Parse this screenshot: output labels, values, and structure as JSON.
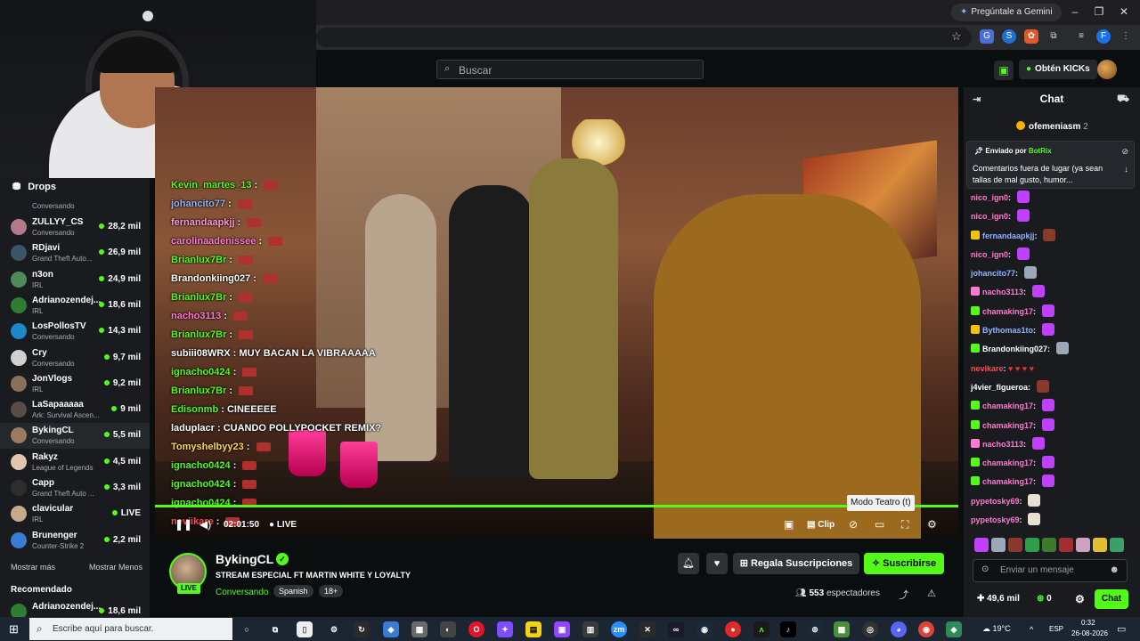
{
  "browser": {
    "gemini_label": "Pregúntale a Gemini"
  },
  "header": {
    "search_placeholder": "Buscar",
    "kicks_label": "Obtén KICKs"
  },
  "sidebar": {
    "drops_label": "Drops",
    "top_partial": {
      "category": "Conversando"
    },
    "following": [
      {
        "name": "ZULLYY_CS",
        "category": "Conversando",
        "viewers": "28,2 mil",
        "color": "#b37a8c"
      },
      {
        "name": "RDjavi",
        "category": "Grand Theft Auto...",
        "viewers": "26,9 mil",
        "color": "#3b5566"
      },
      {
        "name": "n3on",
        "category": "IRL",
        "viewers": "24,9 mil",
        "color": "#4f8a5a"
      },
      {
        "name": "Adrianozendej...",
        "category": "IRL",
        "viewers": "18,6 mil",
        "color": "#2e7d32"
      },
      {
        "name": "LosPollosTV",
        "category": "Conversando",
        "viewers": "14,3 mil",
        "color": "#1b88c9"
      },
      {
        "name": "Cry",
        "category": "Conversando",
        "viewers": "9,7 mil",
        "color": "#d0d0d0"
      },
      {
        "name": "JonVlogs",
        "category": "IRL",
        "viewers": "9,2 mil",
        "color": "#8a6f5a"
      },
      {
        "name": "LaSapaaaaa",
        "category": "Ark: Survival Ascen...",
        "viewers": "9 mil",
        "color": "#5a4b45"
      },
      {
        "name": "BykingCL",
        "category": "Conversando",
        "viewers": "5,5 mil",
        "color": "#9a7a60"
      },
      {
        "name": "Rakyz",
        "category": "League of Legends",
        "viewers": "4,5 mil",
        "color": "#e0c6b0"
      },
      {
        "name": "Capp",
        "category": "Grand Theft Auto ...",
        "viewers": "3,3 mil",
        "color": "#2d2d2d"
      },
      {
        "name": "clavicular",
        "category": "IRL",
        "viewers": "LIVE",
        "color": "#c9a88e"
      },
      {
        "name": "Brunenger",
        "category": "Counter-Strike 2",
        "viewers": "2,2 mil",
        "color": "#3a7bd5"
      }
    ],
    "show_more": "Mostrar más",
    "show_less": "Mostrar Menos",
    "recommended_title": "Recomendado",
    "recommended": [
      {
        "name": "Adrianozendej...",
        "viewers": "18,6 mil",
        "color": "#2e7d32"
      }
    ]
  },
  "video": {
    "overlay_chat": [
      {
        "user": "Kevin_martes_13",
        "color": "#53fc18",
        "text": ""
      },
      {
        "user": "johancito77",
        "color": "#8fb3ff",
        "text": ""
      },
      {
        "user": "fernandaapkjj",
        "color": "#ff9ad5",
        "text": ""
      },
      {
        "user": "carolinaadenissee",
        "color": "#ff7ad0",
        "text": ""
      },
      {
        "user": "Brianlux7Br",
        "color": "#53fc18",
        "text": ""
      },
      {
        "user": "Brandonkiing027",
        "color": "#ffffff",
        "text": ""
      },
      {
        "user": "Brianlux7Br",
        "color": "#53fc18",
        "text": ""
      },
      {
        "user": "nacho3113",
        "color": "#ff7ad0",
        "text": ""
      },
      {
        "user": "Brianlux7Br",
        "color": "#53fc18",
        "text": ""
      },
      {
        "user": "subiii08WRX",
        "color": "#ffffff",
        "text": "MUY BACAN LA VIBRAAAAA"
      },
      {
        "user": "ignacho0424",
        "color": "#53fc18",
        "text": ""
      },
      {
        "user": "Brianlux7Br",
        "color": "#53fc18",
        "text": ""
      },
      {
        "user": "Edisonmb",
        "color": "#53fc18",
        "text": "CINEEEEE"
      },
      {
        "user": "laduplacr",
        "color": "#ffffff",
        "text": "CUANDO POLLYPOCKET REMIX?"
      },
      {
        "user": "Tomyshelbyy23",
        "color": "#ffd84a",
        "text": ""
      },
      {
        "user": "ignacho0424",
        "color": "#53fc18",
        "text": ""
      },
      {
        "user": "ignacho0424",
        "color": "#53fc18",
        "text": ""
      },
      {
        "user": "ignacho0424",
        "color": "#53fc18",
        "text": ""
      },
      {
        "user": "neviikare",
        "color": "#ff4d4d",
        "text": ""
      }
    ],
    "time": "02:01:50",
    "live_label": "LIVE",
    "clip_label": "Clip",
    "tooltip": "Modo Teatro (t)"
  },
  "stream": {
    "channel": "BykingCL",
    "live_badge": "LIVE",
    "title": "STREAM ESPECIAL FT MARTIN WHITE Y LOYALTY",
    "category": "Conversando",
    "tags": [
      "Spanish",
      "18+"
    ],
    "gift_label": "Regala Suscripciones",
    "subscribe_label": "Suscribirse",
    "viewers_count": "553",
    "viewers_label": "espectadores"
  },
  "chat": {
    "title": "Chat",
    "top_gifter": "ofemeniasm",
    "top_gifter_count": "2",
    "pinned_by_label": "Enviado por",
    "pinned_by_user": "BotRix",
    "pinned_message": "Comentarios fuera de lugar (ya sean tallas de mal gusto, humor...",
    "messages": [
      {
        "user": "nico_ign0",
        "color": "#ff7ad0",
        "badge": "",
        "emote": "#c040ff",
        "body": ""
      },
      {
        "user": "nico_ign0",
        "color": "#ff7ad0",
        "badge": "",
        "emote": "#c040ff",
        "body": ""
      },
      {
        "user": "fernandaapkjj",
        "color": "#8fb3ff",
        "badge": "#f5c400",
        "emote": "#8a3a2a",
        "body": ""
      },
      {
        "user": "nico_ign0",
        "color": "#ff7ad0",
        "badge": "",
        "emote": "#c040ff",
        "body": ""
      },
      {
        "user": "johancito77",
        "color": "#8fb3ff",
        "badge": "",
        "emote": "#9aa8b8",
        "body": ""
      },
      {
        "user": "nacho3113",
        "color": "#ff7ad0",
        "badge": "#ff7ad0",
        "emote": "#c040ff",
        "body": ""
      },
      {
        "user": "chamaking17",
        "color": "#ff7ad0",
        "badge": "#53fc18",
        "emote": "#c040ff",
        "body": ""
      },
      {
        "user": "Bythomas1to",
        "color": "#8fb3ff",
        "badge": "#f5c400",
        "emote": "#c040ff",
        "body": ""
      },
      {
        "user": "Brandonkiing027",
        "color": "#ffffff",
        "badge": "#53fc18",
        "emote": "#9aa8b8",
        "body": ""
      },
      {
        "user": "nevikare",
        "color": "#ff4d4d",
        "badge": "",
        "emote": "",
        "body": "♥ ♥ ♥ ♥"
      },
      {
        "user": "j4vier_figueroa",
        "color": "#ffffff",
        "badge": "",
        "emote": "#8a3a2a",
        "body": ""
      },
      {
        "user": "chamaking17",
        "color": "#ff7ad0",
        "badge": "#53fc18",
        "emote": "#c040ff",
        "body": ""
      },
      {
        "user": "chamaking17",
        "color": "#ff7ad0",
        "badge": "#53fc18",
        "emote": "#c040ff",
        "body": ""
      },
      {
        "user": "nacho3113",
        "color": "#ff7ad0",
        "badge": "#ff7ad0",
        "emote": "#c040ff",
        "body": ""
      },
      {
        "user": "chamaking17",
        "color": "#ff7ad0",
        "badge": "#53fc18",
        "emote": "#c040ff",
        "body": ""
      },
      {
        "user": "chamaking17",
        "color": "#ff7ad0",
        "badge": "#53fc18",
        "emote": "#c040ff",
        "body": ""
      },
      {
        "user": "pypetosky69",
        "color": "#ff7ad0",
        "badge": "",
        "emote": "#e8e0d0",
        "body": ""
      },
      {
        "user": "pypetosky69",
        "color": "#ff7ad0",
        "badge": "",
        "emote": "#e8e0d0",
        "body": ""
      }
    ],
    "input_placeholder": "Enviar un mensaje",
    "followers": "49,6 mil",
    "kicks": "0",
    "chat_button": "Chat"
  },
  "taskbar": {
    "search_placeholder": "Escribe aquí para buscar.",
    "weather": "19°C",
    "language": "ESP",
    "time": "0:32",
    "date": "26-08-2026"
  }
}
